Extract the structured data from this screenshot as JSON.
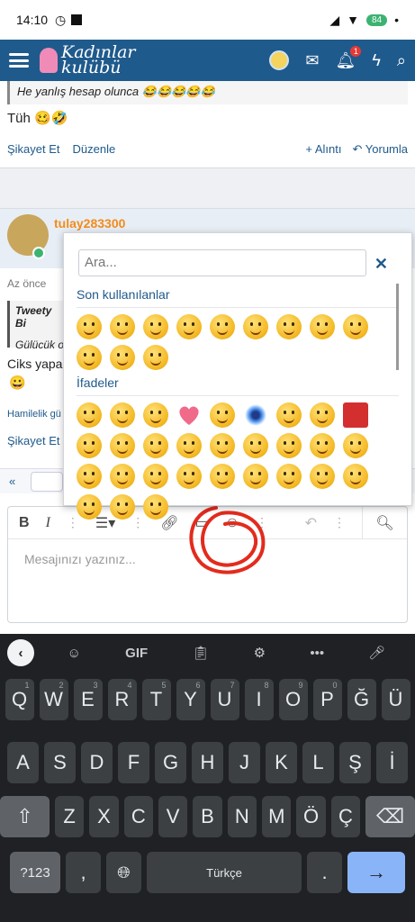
{
  "status_bar": {
    "time": "14:10",
    "battery": "84"
  },
  "app": {
    "logo_line1": "Kadınlar",
    "logo_line2": "kulübü",
    "notif_count": "1"
  },
  "post1": {
    "quote_text": "He yanlış hesap olunca 😂😂😂😂😂",
    "body": "Tüh 🥴🤣",
    "report": "Şikayet Et",
    "edit": "Düzenle",
    "quote_action": "+ Alıntı",
    "reply_action": "Yorumla"
  },
  "post2": {
    "username": "tulay283300",
    "date": "Az önce",
    "quote_author": "Tweety Bi",
    "quote_body": "Gülücük o",
    "body": "Ciks yapar",
    "body_emoji": "😀",
    "tag": "Hamilelik gü",
    "report": "Şikayet Et"
  },
  "editor": {
    "placeholder": "Mesajınızı yazınız...",
    "bold": "B",
    "italic": "I"
  },
  "emoji_popup": {
    "search_placeholder": "Ara...",
    "close": "✕",
    "recent_title": "Son kullanılanlar",
    "expressions_title": "İfadeler"
  },
  "keyboard": {
    "gif": "GIF",
    "row1": [
      [
        "Q",
        "1"
      ],
      [
        "W",
        "2"
      ],
      [
        "E",
        "3"
      ],
      [
        "R",
        "4"
      ],
      [
        "T",
        "5"
      ],
      [
        "Y",
        "6"
      ],
      [
        "U",
        "7"
      ],
      [
        "I",
        "8"
      ],
      [
        "O",
        "9"
      ],
      [
        "P",
        "0"
      ],
      [
        "Ğ",
        ""
      ],
      [
        "Ü",
        ""
      ]
    ],
    "row2": [
      "A",
      "S",
      "D",
      "F",
      "G",
      "H",
      "J",
      "K",
      "L",
      "Ş",
      "İ"
    ],
    "row3": [
      "Z",
      "X",
      "C",
      "V",
      "B",
      "N",
      "M",
      "Ö",
      "Ç"
    ],
    "sym_key": "?123",
    "comma": ",",
    "space": "Türkçe",
    "period": ".",
    "enter": "→"
  }
}
